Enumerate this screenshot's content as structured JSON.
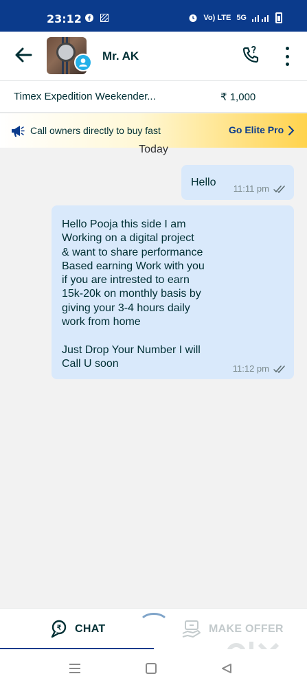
{
  "status_bar": {
    "time": "23:12",
    "network": "Vo) LTE",
    "signal": "5G"
  },
  "header": {
    "seller_name": "Mr. AK"
  },
  "product": {
    "name": "Timex Expedition Weekender...",
    "price": "₹ 1,000"
  },
  "banner": {
    "text": "Call owners directly to buy fast",
    "cta": "Go Elite Pro"
  },
  "chat": {
    "day_label": "Today",
    "messages": [
      {
        "text": "Hello",
        "time": "11:11 pm"
      },
      {
        "text": "Hello Pooja this side I am\nWorking on a digital project\n& want to share performance\nBased earning Work with you\nif you are intrested to earn\n15k-20k on monthly basis by\ngiving your 3-4 hours daily\nwork from home\n\nJust Drop Your Number I will\nCall U soon",
        "time": "11:12 pm"
      }
    ]
  },
  "tabs": {
    "chat_label": "CHAT",
    "offer_label": "MAKE OFFER"
  },
  "colors": {
    "brand_blue": "#0b3b8c",
    "bubble": "#d9e9fb",
    "accent_yellow": "#ffd34d"
  },
  "icons": [
    "back-arrow-icon",
    "phone-icon",
    "more-icon",
    "megaphone-icon",
    "chevron-right-icon",
    "double-check-icon",
    "chat-icon",
    "make-offer-icon"
  ]
}
